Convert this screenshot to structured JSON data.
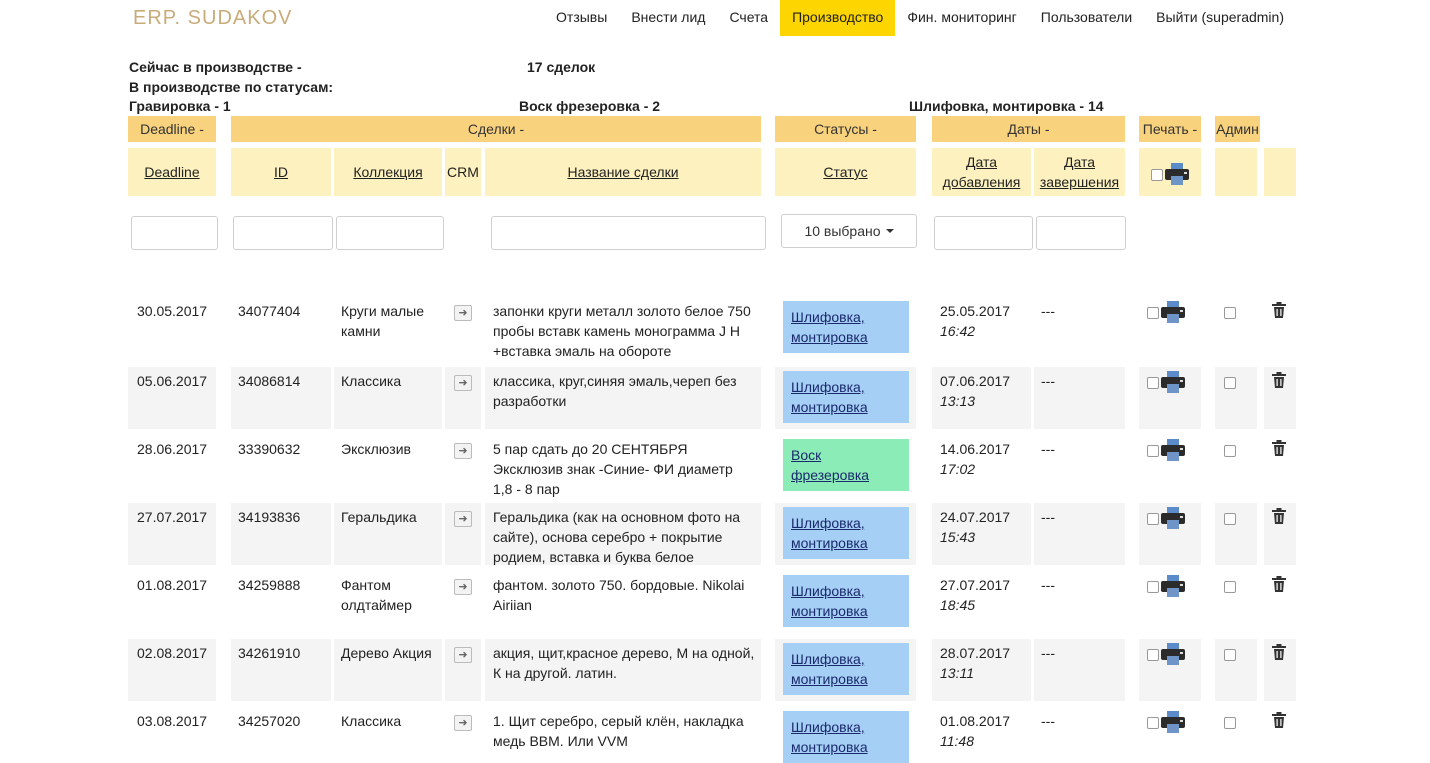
{
  "brand": "ERP. SUDAKOV",
  "nav": [
    "Отзывы",
    "Внести лид",
    "Счета",
    "Производство",
    "Фин. мониторинг",
    "Пользователи",
    "Выйти (superadmin)"
  ],
  "nav_active_index": 3,
  "stats": {
    "in_production_label": "Сейчас в производстве -",
    "in_production_count": "17 сделок",
    "by_status_label": "В производстве по статусам:",
    "status1": "Гравировка - 1",
    "status2": "Воск фрезеровка - 2",
    "status3": "Шлифовка, монтировка - 14"
  },
  "groups": {
    "deadline": "Deadline -",
    "deals": "Сделки -",
    "statuses": "Статусы -",
    "dates": "Даты -",
    "print": "Печать -",
    "admin": "Админ"
  },
  "headers": {
    "deadline": "Deadline",
    "id": "ID",
    "collection": "Коллекция",
    "crm": "CRM",
    "name": "Название сделки",
    "status": "Статус",
    "date_added": "Дата добавления",
    "date_done": "Дата завершения"
  },
  "filters": {
    "status_selected": "10 выбрано"
  },
  "status_colors": {
    "Шлифовка, монтировка": "#a6cff5",
    "Воск фрезеровка": "#8cecb8"
  },
  "rows": [
    {
      "deadline": "30.05.2017",
      "id": "34077404",
      "collection": "Круги малые камни",
      "name": "запонки круги металл золото белое 750 пробы вставк камень монограмма J H +вставка эмаль на обороте",
      "status": "Шлифовка, монтировка",
      "date": "25.05.2017",
      "time": "16:42",
      "done": "---"
    },
    {
      "deadline": "05.06.2017",
      "id": "34086814",
      "collection": "Классика",
      "name": "классика, круг,синяя эмаль,череп без разработки",
      "status": "Шлифовка, монтировка",
      "date": "07.06.2017",
      "time": "13:13",
      "done": "---"
    },
    {
      "deadline": "28.06.2017",
      "id": "33390632",
      "collection": "Эксклюзив",
      "name": "5 пар сдать до 20 СЕНТЯБРЯ Эксклюзив знак -Синие- ФИ диаметр 1,8 - 8 пар",
      "status": "Воск фрезеровка",
      "date": "14.06.2017",
      "time": "17:02",
      "done": "---"
    },
    {
      "deadline": "27.07.2017",
      "id": "34193836",
      "collection": "Геральдика",
      "name": "Геральдика (как на основном фото на сайте), основа серебро + покрытие родием, вставка и буква белое",
      "status": "Шлифовка, монтировка",
      "date": "24.07.2017",
      "time": "15:43",
      "done": "---"
    },
    {
      "deadline": "01.08.2017",
      "id": "34259888",
      "collection": "Фантом олдтаймер",
      "name": "фантом. золото 750. бордовые. Nikolai Airiian",
      "status": "Шлифовка, монтировка",
      "date": "27.07.2017",
      "time": "18:45",
      "done": "---"
    },
    {
      "deadline": "02.08.2017",
      "id": "34261910",
      "collection": "Дерево Акция",
      "name": "акция, щит,красное дерево, М на одной, К на другой. латин.",
      "status": "Шлифовка, монтировка",
      "date": "28.07.2017",
      "time": "13:11",
      "done": "---"
    },
    {
      "deadline": "03.08.2017",
      "id": "34257020",
      "collection": "Классика",
      "name": "1. Щит серебро, серый клён, накладка медь ВВМ. Или VVM",
      "status": "Шлифовка, монтировка",
      "date": "01.08.2017",
      "time": "11:48",
      "done": "---"
    }
  ]
}
